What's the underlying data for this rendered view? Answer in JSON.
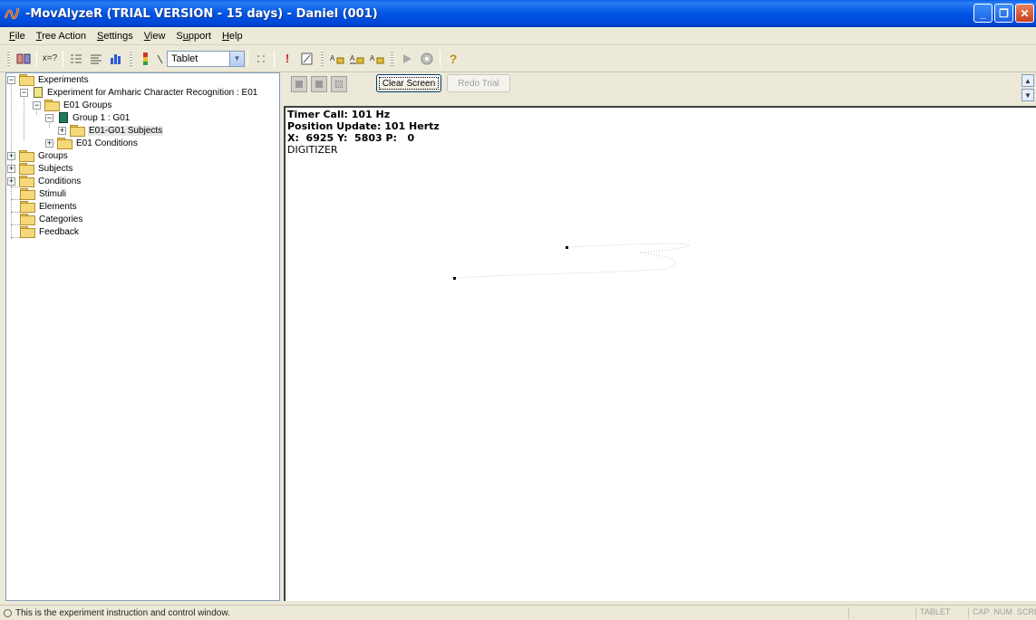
{
  "window": {
    "title": "-MovAlyzeR (TRIAL VERSION - 15 days) - Daniel (001)"
  },
  "menu": [
    {
      "label": "File",
      "u": "F"
    },
    {
      "label": "Tree Action",
      "u": "T"
    },
    {
      "label": "Settings",
      "u": "S"
    },
    {
      "label": "View",
      "u": "V"
    },
    {
      "label": "Support",
      "u": "u"
    },
    {
      "label": "Help",
      "u": "H"
    }
  ],
  "toolbar": {
    "device_select_value": "Tablet",
    "icons": [
      "experiment-wizard-icon",
      "calculate-icon",
      "list-icon",
      "align-icon",
      "bar-chart-icon",
      "color-bar-icon",
      "pen-icon",
      "grid-icon",
      "alert-icon",
      "edit-icon",
      "font-a-icon",
      "font-b-icon",
      "font-c-icon",
      "play-icon",
      "record-icon",
      "help-icon"
    ]
  },
  "tree": {
    "experiments": "Experiments",
    "experiment": "Experiment for Amharic Character Recognition : E01",
    "groups_folder": "E01 Groups",
    "group": "Group 1 : G01",
    "subjects_folder": "E01-G01 Subjects",
    "conditions_folder": "E01 Conditions",
    "root_groups": "Groups",
    "root_subjects": "Subjects",
    "root_conditions": "Conditions",
    "root_stimuli": "Stimuli",
    "root_elements": "Elements",
    "root_categories": "Categories",
    "root_feedback": "Feedback"
  },
  "controls": {
    "clear_screen": "Clear Screen",
    "redo_trial": "Redo Trial"
  },
  "readout": {
    "timer_call": "Timer Call: 101 Hz",
    "position_update": "Position Update: 101 Hertz",
    "xyp": "X:  6925 Y:  5803 P:   0",
    "source": "DIGITIZER"
  },
  "status": {
    "message": "This is the experiment instruction and control window.",
    "tablet": "TABLET",
    "keys": "CAP  NUM  SCRL"
  },
  "colors": {
    "titlebar": "#0055E5",
    "chrome": "#ECE9D8"
  }
}
